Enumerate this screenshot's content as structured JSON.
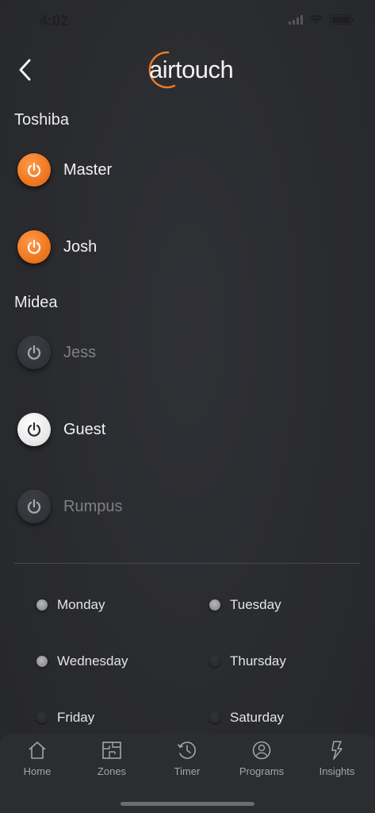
{
  "status_bar": {
    "time": "4:02"
  },
  "header": {
    "logo_text": "airtouch"
  },
  "groups": [
    {
      "label": "Toshiba",
      "zones": [
        {
          "name": "Master",
          "state": "on"
        },
        {
          "name": "Josh",
          "state": "on"
        }
      ]
    },
    {
      "label": "Midea",
      "zones": [
        {
          "name": "Jess",
          "state": "off"
        },
        {
          "name": "Guest",
          "state": "selected"
        },
        {
          "name": "Rumpus",
          "state": "off"
        }
      ]
    }
  ],
  "days": [
    {
      "label": "Monday",
      "selected": true
    },
    {
      "label": "Tuesday",
      "selected": true
    },
    {
      "label": "Wednesday",
      "selected": true
    },
    {
      "label": "Thursday",
      "selected": false
    },
    {
      "label": "Friday",
      "selected": false
    },
    {
      "label": "Saturday",
      "selected": false
    }
  ],
  "tabs": [
    {
      "label": "Home",
      "icon": "home-icon"
    },
    {
      "label": "Zones",
      "icon": "zones-icon"
    },
    {
      "label": "Timer",
      "icon": "timer-icon"
    },
    {
      "label": "Programs",
      "icon": "programs-icon"
    },
    {
      "label": "Insights",
      "icon": "insights-icon"
    }
  ],
  "colors": {
    "accent_on": "#f07a22",
    "background": "#2a2b2f",
    "text_dim": "#7f8087"
  }
}
